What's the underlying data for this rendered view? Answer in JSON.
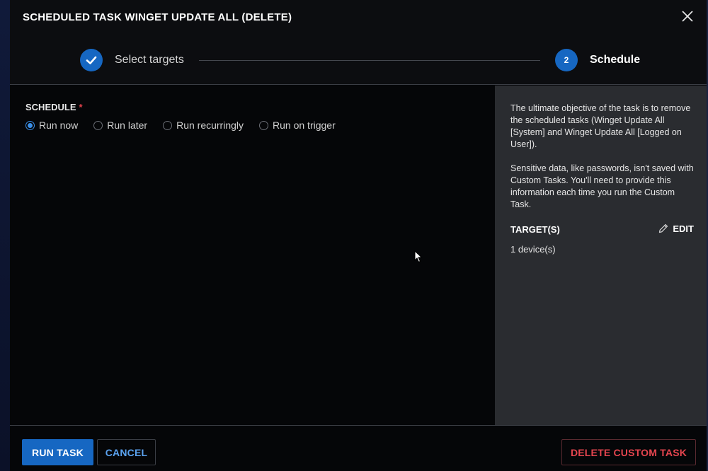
{
  "dialog": {
    "title": "SCHEDULED TASK WINGET UPDATE ALL (DELETE)"
  },
  "stepper": {
    "steps": [
      {
        "label": "Select targets",
        "state": "completed"
      },
      {
        "number": "2",
        "label": "Schedule",
        "state": "active"
      }
    ]
  },
  "schedule": {
    "label": "SCHEDULE",
    "required_mark": "*",
    "options": [
      {
        "label": "Run now",
        "selected": true
      },
      {
        "label": "Run later",
        "selected": false
      },
      {
        "label": "Run recurringly",
        "selected": false
      },
      {
        "label": "Run on trigger",
        "selected": false
      }
    ]
  },
  "side_panel": {
    "description_1": "The ultimate objective of the task is to remove the scheduled tasks (Winget Update All [System] and Winget Update All [Logged on User]).",
    "description_2": "Sensitive data, like passwords, isn't saved with Custom Tasks. You'll need to provide this information each time you run the Custom Task.",
    "targets_title": "TARGET(S)",
    "edit_label": "EDIT",
    "targets_value": "1 device(s)"
  },
  "footer": {
    "run_label": "RUN TASK",
    "cancel_label": "CANCEL",
    "delete_label": "DELETE CUSTOM TASK"
  },
  "colors": {
    "accent": "#1667c2",
    "link": "#5aa2ef",
    "danger": "#e5454f",
    "side_panel_bg": "#2a2c30",
    "dialog_bg": "#050608"
  },
  "icons": {
    "close": "close-icon",
    "step_complete": "checkmark-icon",
    "edit": "pencil-icon",
    "cursor": "mouse-pointer-icon"
  }
}
